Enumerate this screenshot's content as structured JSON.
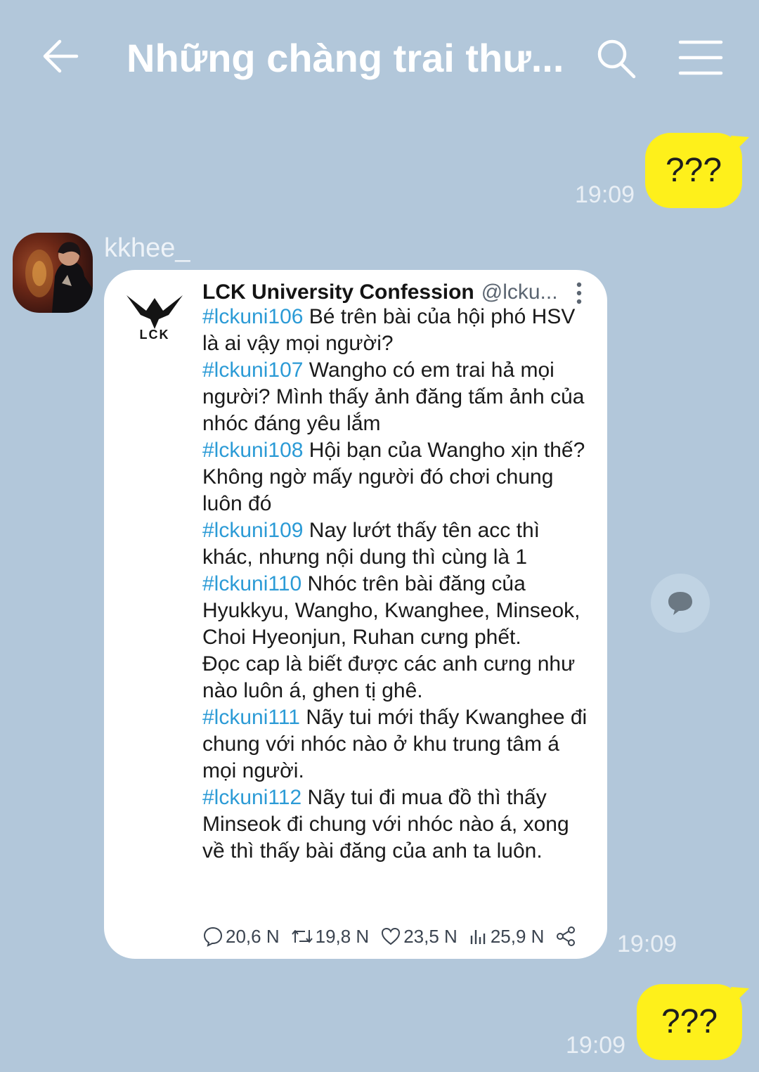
{
  "header": {
    "title": "Những chàng trai thư..."
  },
  "messages": {
    "out1": {
      "text": "???",
      "time": "19:09"
    },
    "incoming": {
      "sender": "kkhee_",
      "time": "19:09",
      "tweet": {
        "author": "LCK University Confession",
        "handle": "@lcku...",
        "logo_text": "LCK",
        "posts": [
          {
            "tag": "#lckuni106",
            "text": " Bé trên bài của hội phó HSV là ai vậy mọi người?"
          },
          {
            "tag": "#lckuni107",
            "text": " Wangho có em trai hả mọi người? Mình thấy ảnh đăng tấm ảnh của nhóc đáng yêu lắm"
          },
          {
            "tag": "#lckuni108",
            "text": " Hội bạn của Wangho xịn thế? Không ngờ mấy người đó chơi chung luôn đó"
          },
          {
            "tag": "#lckuni109",
            "text": " Nay lướt thấy tên acc thì khác, nhưng nội dung thì cùng là 1"
          },
          {
            "tag": "#lckuni110",
            "text": " Nhóc trên bài đăng của Hyukkyu, Wangho, Kwanghee, Minseok, Choi Hyeonjun, Ruhan cưng phết."
          },
          {
            "tag": "",
            "text": "Đọc cap là biết được các anh cưng như nào luôn á, ghen tị ghê."
          },
          {
            "tag": "#lckuni111",
            "text": " Nãy tui mới thấy Kwanghee đi chung với nhóc nào ở khu trung tâm á mọi người."
          },
          {
            "tag": "#lckuni112",
            "text": " Nãy tui đi mua đồ thì thấy Minseok đi chung với nhóc nào á, xong về thì thấy bài đăng của anh ta luôn."
          }
        ],
        "stats": {
          "replies": "20,6 N",
          "retweets": "19,8 N",
          "likes": "23,5 N",
          "views": "25,9 N"
        }
      }
    },
    "out2": {
      "text": "???",
      "time": "19:09"
    }
  },
  "colors": {
    "background": "#b2c7da",
    "bubble_out": "#fef01b",
    "hashtag": "#2c9bd6"
  },
  "icons": [
    "back-arrow-icon",
    "search-icon",
    "menu-icon",
    "more-vertical-icon",
    "reply-icon",
    "retweet-icon",
    "like-icon",
    "views-icon",
    "share-icon",
    "comment-bubble-icon"
  ]
}
